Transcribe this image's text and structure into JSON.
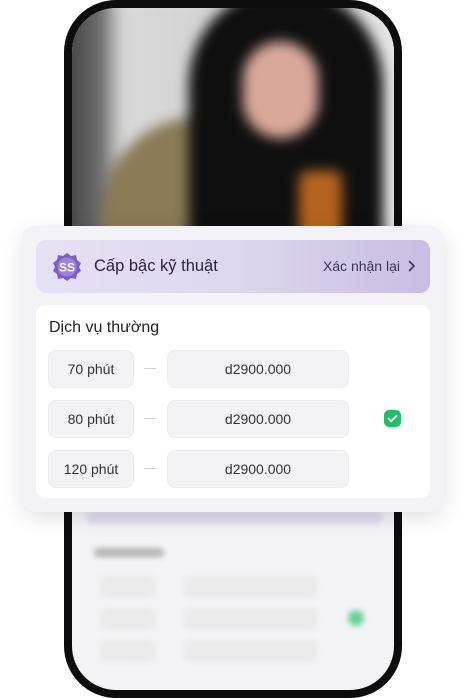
{
  "card": {
    "title": "Cấp bậc kỹ thuật",
    "badge_letters": "SS",
    "confirm_label": "Xác nhận lại",
    "confirm_icon": "chevron-right-icon"
  },
  "service": {
    "title": "Dịch vụ thường",
    "rows": [
      {
        "duration": "70 phút",
        "price": "d2900.000",
        "selected": false
      },
      {
        "duration": "80 phút",
        "price": "d2900.000",
        "selected": true
      },
      {
        "duration": "120 phút",
        "price": "d2900.000",
        "selected": false
      }
    ]
  },
  "colors": {
    "accent_check": "#22bf6b",
    "badge_purple": "#7b5fc8",
    "header_gradient_start": "#e6e1f4",
    "header_gradient_end": "#c9bde2"
  }
}
